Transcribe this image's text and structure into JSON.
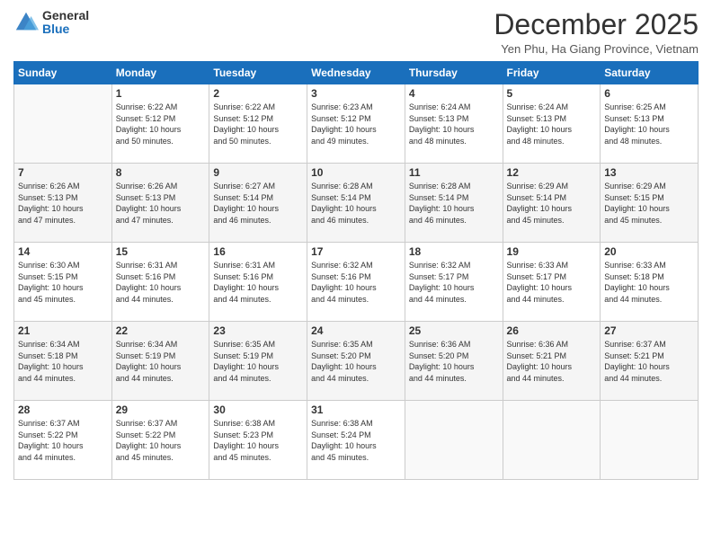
{
  "logo": {
    "general": "General",
    "blue": "Blue"
  },
  "header": {
    "title": "December 2025",
    "location": "Yen Phu, Ha Giang Province, Vietnam"
  },
  "weekdays": [
    "Sunday",
    "Monday",
    "Tuesday",
    "Wednesday",
    "Thursday",
    "Friday",
    "Saturday"
  ],
  "weeks": [
    [
      {
        "day": "",
        "info": ""
      },
      {
        "day": "1",
        "info": "Sunrise: 6:22 AM\nSunset: 5:12 PM\nDaylight: 10 hours\nand 50 minutes."
      },
      {
        "day": "2",
        "info": "Sunrise: 6:22 AM\nSunset: 5:12 PM\nDaylight: 10 hours\nand 50 minutes."
      },
      {
        "day": "3",
        "info": "Sunrise: 6:23 AM\nSunset: 5:12 PM\nDaylight: 10 hours\nand 49 minutes."
      },
      {
        "day": "4",
        "info": "Sunrise: 6:24 AM\nSunset: 5:13 PM\nDaylight: 10 hours\nand 48 minutes."
      },
      {
        "day": "5",
        "info": "Sunrise: 6:24 AM\nSunset: 5:13 PM\nDaylight: 10 hours\nand 48 minutes."
      },
      {
        "day": "6",
        "info": "Sunrise: 6:25 AM\nSunset: 5:13 PM\nDaylight: 10 hours\nand 48 minutes."
      }
    ],
    [
      {
        "day": "7",
        "info": "Sunrise: 6:26 AM\nSunset: 5:13 PM\nDaylight: 10 hours\nand 47 minutes."
      },
      {
        "day": "8",
        "info": "Sunrise: 6:26 AM\nSunset: 5:13 PM\nDaylight: 10 hours\nand 47 minutes."
      },
      {
        "day": "9",
        "info": "Sunrise: 6:27 AM\nSunset: 5:14 PM\nDaylight: 10 hours\nand 46 minutes."
      },
      {
        "day": "10",
        "info": "Sunrise: 6:28 AM\nSunset: 5:14 PM\nDaylight: 10 hours\nand 46 minutes."
      },
      {
        "day": "11",
        "info": "Sunrise: 6:28 AM\nSunset: 5:14 PM\nDaylight: 10 hours\nand 46 minutes."
      },
      {
        "day": "12",
        "info": "Sunrise: 6:29 AM\nSunset: 5:14 PM\nDaylight: 10 hours\nand 45 minutes."
      },
      {
        "day": "13",
        "info": "Sunrise: 6:29 AM\nSunset: 5:15 PM\nDaylight: 10 hours\nand 45 minutes."
      }
    ],
    [
      {
        "day": "14",
        "info": "Sunrise: 6:30 AM\nSunset: 5:15 PM\nDaylight: 10 hours\nand 45 minutes."
      },
      {
        "day": "15",
        "info": "Sunrise: 6:31 AM\nSunset: 5:16 PM\nDaylight: 10 hours\nand 44 minutes."
      },
      {
        "day": "16",
        "info": "Sunrise: 6:31 AM\nSunset: 5:16 PM\nDaylight: 10 hours\nand 44 minutes."
      },
      {
        "day": "17",
        "info": "Sunrise: 6:32 AM\nSunset: 5:16 PM\nDaylight: 10 hours\nand 44 minutes."
      },
      {
        "day": "18",
        "info": "Sunrise: 6:32 AM\nSunset: 5:17 PM\nDaylight: 10 hours\nand 44 minutes."
      },
      {
        "day": "19",
        "info": "Sunrise: 6:33 AM\nSunset: 5:17 PM\nDaylight: 10 hours\nand 44 minutes."
      },
      {
        "day": "20",
        "info": "Sunrise: 6:33 AM\nSunset: 5:18 PM\nDaylight: 10 hours\nand 44 minutes."
      }
    ],
    [
      {
        "day": "21",
        "info": "Sunrise: 6:34 AM\nSunset: 5:18 PM\nDaylight: 10 hours\nand 44 minutes."
      },
      {
        "day": "22",
        "info": "Sunrise: 6:34 AM\nSunset: 5:19 PM\nDaylight: 10 hours\nand 44 minutes."
      },
      {
        "day": "23",
        "info": "Sunrise: 6:35 AM\nSunset: 5:19 PM\nDaylight: 10 hours\nand 44 minutes."
      },
      {
        "day": "24",
        "info": "Sunrise: 6:35 AM\nSunset: 5:20 PM\nDaylight: 10 hours\nand 44 minutes."
      },
      {
        "day": "25",
        "info": "Sunrise: 6:36 AM\nSunset: 5:20 PM\nDaylight: 10 hours\nand 44 minutes."
      },
      {
        "day": "26",
        "info": "Sunrise: 6:36 AM\nSunset: 5:21 PM\nDaylight: 10 hours\nand 44 minutes."
      },
      {
        "day": "27",
        "info": "Sunrise: 6:37 AM\nSunset: 5:21 PM\nDaylight: 10 hours\nand 44 minutes."
      }
    ],
    [
      {
        "day": "28",
        "info": "Sunrise: 6:37 AM\nSunset: 5:22 PM\nDaylight: 10 hours\nand 44 minutes."
      },
      {
        "day": "29",
        "info": "Sunrise: 6:37 AM\nSunset: 5:22 PM\nDaylight: 10 hours\nand 45 minutes."
      },
      {
        "day": "30",
        "info": "Sunrise: 6:38 AM\nSunset: 5:23 PM\nDaylight: 10 hours\nand 45 minutes."
      },
      {
        "day": "31",
        "info": "Sunrise: 6:38 AM\nSunset: 5:24 PM\nDaylight: 10 hours\nand 45 minutes."
      },
      {
        "day": "",
        "info": ""
      },
      {
        "day": "",
        "info": ""
      },
      {
        "day": "",
        "info": ""
      }
    ]
  ]
}
